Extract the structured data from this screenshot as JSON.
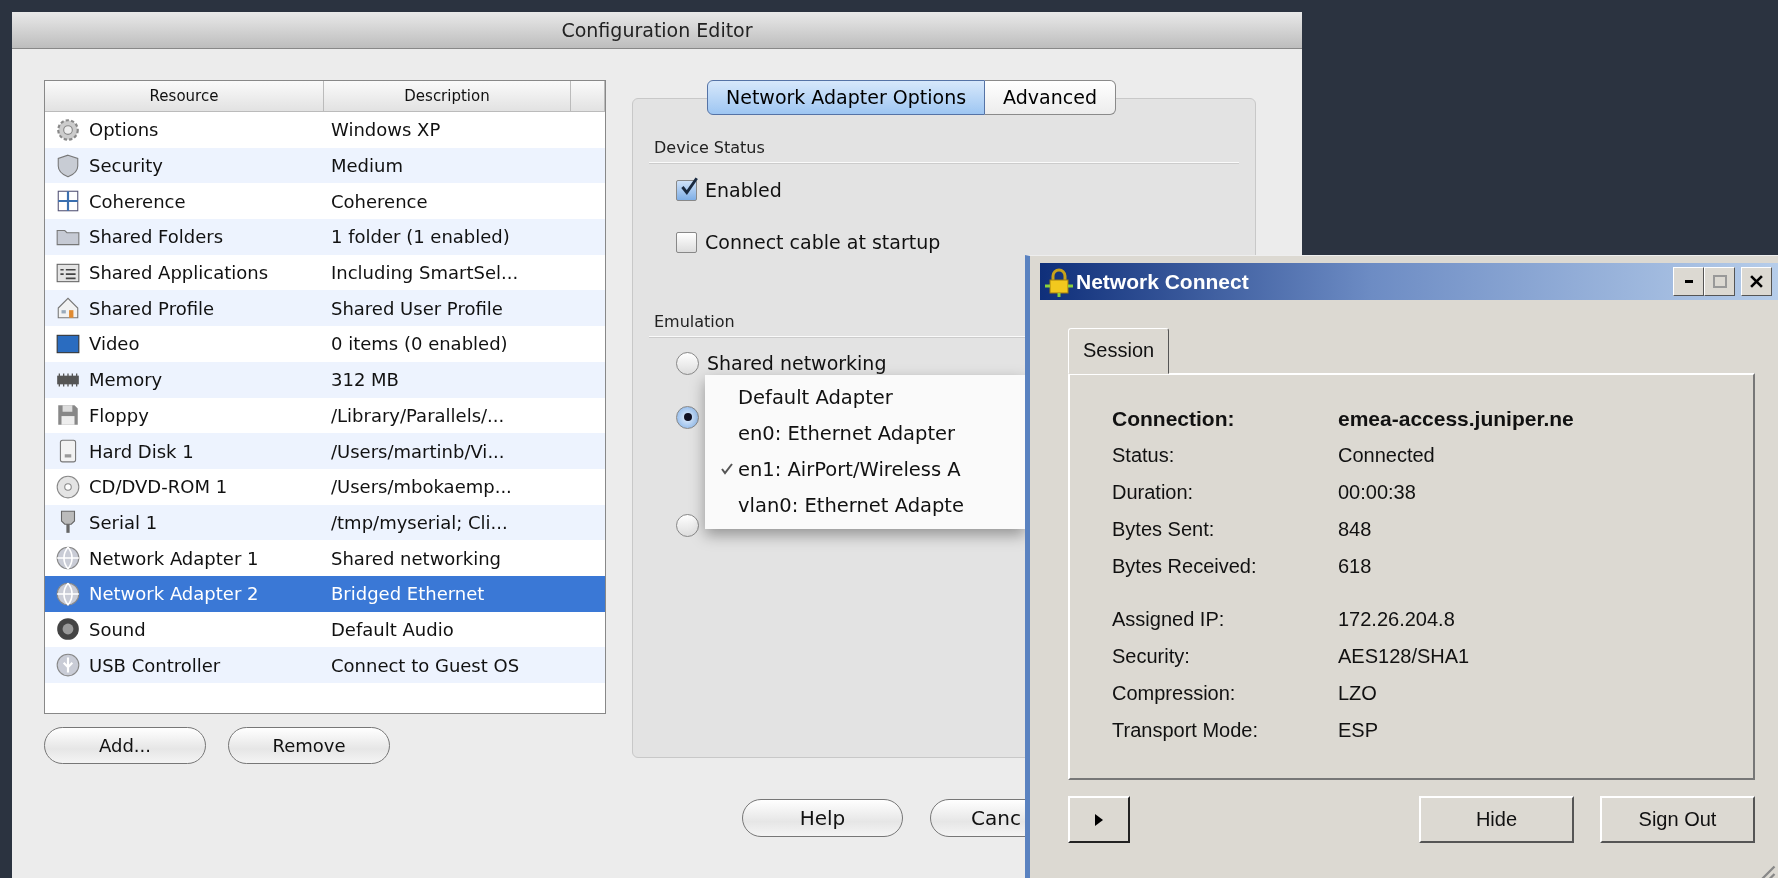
{
  "config_editor": {
    "title": "Configuration Editor",
    "resources": {
      "columns": [
        "Resource",
        "Description"
      ],
      "rows": [
        {
          "resource": "Options",
          "description": "Windows XP",
          "selected": false
        },
        {
          "resource": "Security",
          "description": "Medium",
          "selected": false
        },
        {
          "resource": "Coherence",
          "description": "Coherence",
          "selected": false
        },
        {
          "resource": "Shared Folders",
          "description": "1 folder (1 enabled)",
          "selected": false
        },
        {
          "resource": "Shared Applications",
          "description": "Including SmartSel...",
          "selected": false
        },
        {
          "resource": "Shared Profile",
          "description": "Shared User Profile",
          "selected": false
        },
        {
          "resource": "Video",
          "description": "0 items (0 enabled)",
          "selected": false
        },
        {
          "resource": "Memory",
          "description": "312 MB",
          "selected": false
        },
        {
          "resource": "Floppy",
          "description": "/Library/Parallels/...",
          "selected": false
        },
        {
          "resource": "Hard Disk 1",
          "description": "/Users/martinb/Vi...",
          "selected": false
        },
        {
          "resource": "CD/DVD-ROM 1",
          "description": "/Users/mbokaemp...",
          "selected": false
        },
        {
          "resource": "Serial 1",
          "description": "/tmp/myserial; Cli...",
          "selected": false
        },
        {
          "resource": "Network Adapter 1",
          "description": "Shared networking",
          "selected": false
        },
        {
          "resource": "Network Adapter 2",
          "description": "Bridged Ethernet",
          "selected": true
        },
        {
          "resource": "Sound",
          "description": "Default Audio",
          "selected": false
        },
        {
          "resource": "USB Controller",
          "description": "Connect to Guest OS",
          "selected": false
        }
      ]
    },
    "list_buttons": [
      "Add...",
      "Remove"
    ],
    "tabs": [
      {
        "label": "Network Adapter Options",
        "selected": true
      },
      {
        "label": "Advanced",
        "selected": false
      }
    ],
    "device_status": {
      "heading": "Device Status",
      "checkboxes": [
        {
          "label": "Enabled",
          "checked": true
        },
        {
          "label": "Connect cable at startup",
          "checked": false
        }
      ]
    },
    "emulation": {
      "heading": "Emulation",
      "options": [
        {
          "label": "Shared networking",
          "selected": false
        },
        {
          "selected": true
        },
        {
          "selected": false
        }
      ]
    },
    "adapter_menu": [
      {
        "label": "Default Adapter",
        "checked": false
      },
      {
        "label": "en0: Ethernet Adapter",
        "checked": false
      },
      {
        "label": "en1: AirPort/Wireless A",
        "checked": true
      },
      {
        "label": "vlan0: Ethernet Adapte",
        "checked": false
      }
    ],
    "footer_buttons": [
      "Help",
      "Canc"
    ]
  },
  "network_connect": {
    "title": "Network Connect",
    "tab": {
      "label": "Session",
      "selected": true
    },
    "field_groups": [
      [
        {
          "label": "Connection:",
          "value": "emea-access.juniper.ne",
          "kind": "heading"
        },
        {
          "label": "Status:",
          "value": "Connected",
          "kind": "plain"
        },
        {
          "label": "Duration:",
          "value": "00:00:38",
          "kind": "plain"
        },
        {
          "label": "Bytes Sent:",
          "value": "848",
          "kind": "plain"
        },
        {
          "label": "Bytes Received:",
          "value": "618",
          "kind": "plain"
        }
      ],
      [
        {
          "label": "Assigned IP:",
          "value": "172.26.204.8",
          "kind": "plain"
        },
        {
          "label": "Security:",
          "value": "AES128/SHA1",
          "kind": "plain"
        },
        {
          "label": "Compression:",
          "value": "LZO",
          "kind": "plain"
        },
        {
          "label": "Transport Mode:",
          "value": "ESP",
          "kind": "plain"
        }
      ]
    ],
    "buttons": [
      "Hide",
      "Sign Out"
    ]
  }
}
